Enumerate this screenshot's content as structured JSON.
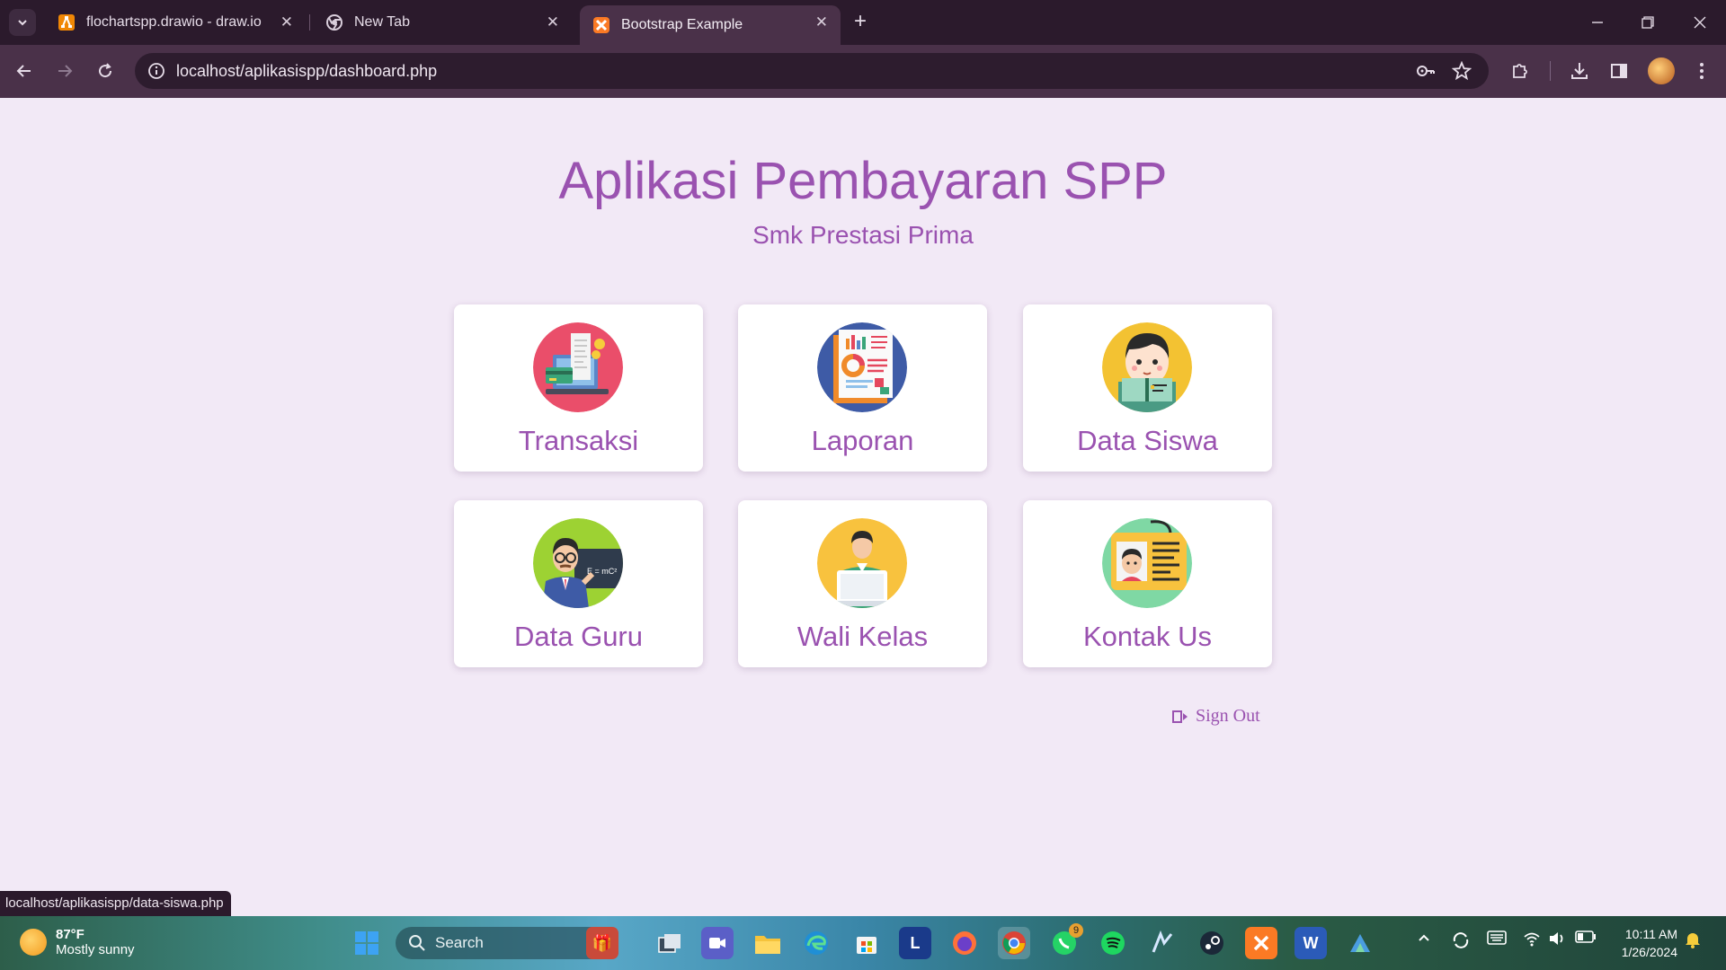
{
  "browser": {
    "tabs": [
      {
        "title": "flochartspp.drawio - draw.io",
        "icon": "drawio-icon"
      },
      {
        "title": "New Tab",
        "icon": "chrome-icon"
      },
      {
        "title": "Bootstrap Example",
        "icon": "xampp-icon",
        "active": true
      }
    ],
    "url": "localhost/aplikasispp/dashboard.php",
    "status_url": "localhost/aplikasispp/data-siswa.php"
  },
  "page": {
    "title": "Aplikasi Pembayaran SPP",
    "subtitle": "Smk Prestasi Prima",
    "cards": [
      {
        "label": "Transaksi",
        "icon": "payment-laptop-icon"
      },
      {
        "label": "Laporan",
        "icon": "report-chart-icon"
      },
      {
        "label": "Data Siswa",
        "icon": "student-reading-icon"
      },
      {
        "label": "Data Guru",
        "icon": "teacher-blackboard-icon"
      },
      {
        "label": "Wali Kelas",
        "icon": "homeroom-teacher-laptop-icon"
      },
      {
        "label": "Kontak Us",
        "icon": "contact-id-card-icon"
      }
    ],
    "signout_label": "Sign Out",
    "accent_color": "#9a52b0",
    "background_color": "#f2e9f6"
  },
  "taskbar": {
    "weather_temp": "87°F",
    "weather_desc": "Mostly sunny",
    "search_placeholder": "Search",
    "whatsapp_badge": "9",
    "time": "10:11 AM",
    "date": "1/26/2024"
  }
}
